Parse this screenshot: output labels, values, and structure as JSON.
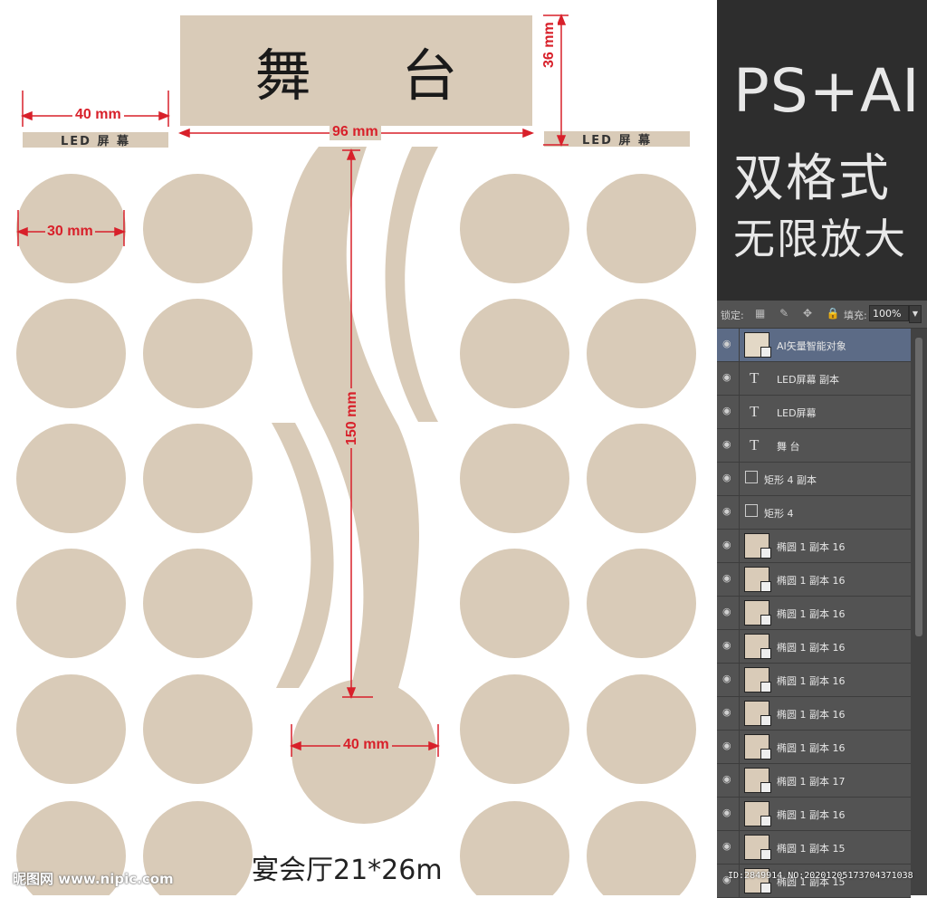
{
  "colors": {
    "beige": "#d9cbb8",
    "dimension": "#d8202a",
    "panel_bg": "#2d2d2d",
    "layer_bg": "#535353",
    "layer_selected": "#5c6b86"
  },
  "stage": {
    "title": "舞 台"
  },
  "led": {
    "left": "LED 屏 幕",
    "right": "LED 屏 幕"
  },
  "dimensions": {
    "led_width": "40 mm",
    "stage_width": "96 mm",
    "stage_height": "36 mm",
    "table_diameter": "30 mm",
    "aisle_length": "150 mm",
    "round_stage_diameter": "40 mm"
  },
  "caption": "宴会厅21*26m",
  "watermark": "昵图网 www.nipic.com",
  "promo": {
    "line1": "PS+AI",
    "line2": "双格式",
    "line3": "无限放大"
  },
  "ps_panel": {
    "lock_label": "锁定:",
    "lock_icons": "▦ ✎ ✥ 🔒",
    "fill_label": "填充:",
    "fill_value": "100%",
    "layers": [
      {
        "name": "AI矢量智能对象",
        "kind": "smart",
        "selected": true
      },
      {
        "name": "LED屏幕 副本",
        "kind": "text"
      },
      {
        "name": "LED屏幕",
        "kind": "text"
      },
      {
        "name": "舞 台",
        "kind": "text"
      },
      {
        "name": "矩形 4 副本",
        "kind": "shape"
      },
      {
        "name": "矩形 4",
        "kind": "shape"
      },
      {
        "name": "椭圆 1 副本 16",
        "kind": "smart"
      },
      {
        "name": "椭圆 1 副本 16",
        "kind": "smart"
      },
      {
        "name": "椭圆 1 副本 16",
        "kind": "smart"
      },
      {
        "name": "椭圆 1 副本 16",
        "kind": "smart"
      },
      {
        "name": "椭圆 1 副本 16",
        "kind": "smart"
      },
      {
        "name": "椭圆 1 副本 16",
        "kind": "smart"
      },
      {
        "name": "椭圆 1 副本 16",
        "kind": "smart"
      },
      {
        "name": "椭圆 1 副本 17",
        "kind": "smart"
      },
      {
        "name": "椭圆 1 副本 16",
        "kind": "smart"
      },
      {
        "name": "椭圆 1 副本 15",
        "kind": "smart"
      },
      {
        "name": "椭圆 1 副本 15",
        "kind": "smart"
      }
    ]
  },
  "image_id": "ID:2849914 NO:20201205173704371038"
}
